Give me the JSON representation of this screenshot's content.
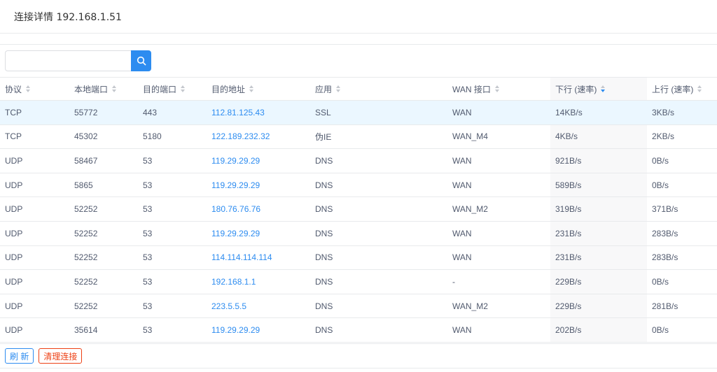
{
  "header": {
    "title": "连接详情 192.168.1.51"
  },
  "search": {
    "placeholder": "",
    "value": "",
    "icon": "search-icon"
  },
  "table": {
    "columns": [
      "协议",
      "本地端口",
      "目的端口",
      "目的地址",
      "应用",
      "WAN 接口",
      "下行 (速率)",
      "上行 (速率)"
    ],
    "rows": [
      [
        "TCP",
        "55772",
        "443",
        "112.81.125.43",
        "SSL",
        "WAN",
        "14KB/s",
        "3KB/s"
      ],
      [
        "TCP",
        "45302",
        "5180",
        "122.189.232.32",
        "伪IE",
        "WAN_M4",
        "4KB/s",
        "2KB/s"
      ],
      [
        "UDP",
        "58467",
        "53",
        "119.29.29.29",
        "DNS",
        "WAN",
        "921B/s",
        "0B/s"
      ],
      [
        "UDP",
        "5865",
        "53",
        "119.29.29.29",
        "DNS",
        "WAN",
        "589B/s",
        "0B/s"
      ],
      [
        "UDP",
        "52252",
        "53",
        "180.76.76.76",
        "DNS",
        "WAN_M2",
        "319B/s",
        "371B/s"
      ],
      [
        "UDP",
        "52252",
        "53",
        "119.29.29.29",
        "DNS",
        "WAN",
        "231B/s",
        "283B/s"
      ],
      [
        "UDP",
        "52252",
        "53",
        "114.114.114.114",
        "DNS",
        "WAN",
        "231B/s",
        "283B/s"
      ],
      [
        "UDP",
        "52252",
        "53",
        "192.168.1.1",
        "DNS",
        "-",
        "229B/s",
        "0B/s"
      ],
      [
        "UDP",
        "52252",
        "53",
        "223.5.5.5",
        "DNS",
        "WAN_M2",
        "229B/s",
        "281B/s"
      ],
      [
        "UDP",
        "35614",
        "53",
        "119.29.29.29",
        "DNS",
        "WAN",
        "202B/s",
        "0B/s"
      ]
    ]
  },
  "footer": {
    "refresh_label": "刷 新",
    "clear_label": "清理连接"
  },
  "colors": {
    "accent": "#2d8cf0",
    "danger": "#ed4014",
    "highlight_row": "#ebf7ff"
  }
}
